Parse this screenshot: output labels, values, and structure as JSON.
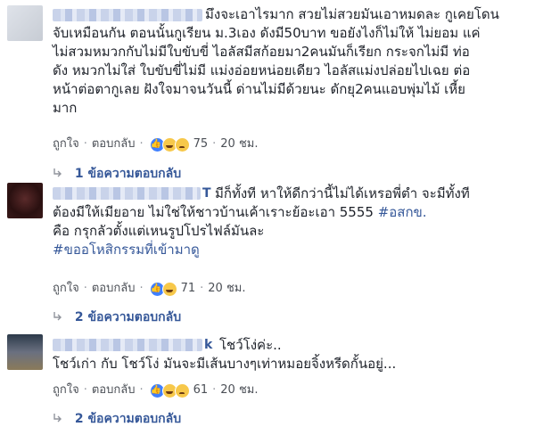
{
  "comments": [
    {
      "name_suffix": "",
      "lines": [
        "มึงจะเอาไรมาก สวยไม่สวยมันเอาหมดละ กูเคยโดน",
        "จับเหมือนกัน ตอนนั้นกูเรียน ม.3เอง ดังมี50บาท ขอยังไงก็ไม่ให้ ไม่ยอม แค่",
        "ไม่สวมหมวกกับไม่มีใบขับขี่ ไอลัสมีสก้อยมา2คนมันก็เรียก กระจกไม่มี ท่อ",
        "ดัง หมวกไม่ใส่ ใบขับขี่ไม่มี แม่งอ่อยหน่อยเดียว ไอลัสแม่งปล่อยไปเฉย ต่อ",
        "หน้าต่อตากูเลย ฝังใจมาจนวันนี้ ด่านไม่มีด้วยนะ ดักยุ2คนแอบพุ่มไม้ เหี้ย",
        "มาก"
      ],
      "like": "ถูกใจ",
      "reply": "ตอบกลับ",
      "count": "75",
      "time": "20 ชม.",
      "replies": "1 ข้อความตอบกลับ"
    },
    {
      "name_suffix": "T",
      "lines": [
        "มีก็ทั้งที หาให้ดีกว่านี้ไม่ได้เหรอพี่ตำ จะมีทั้งที",
        "ต้องมีให้เมียอาย ไม่ใช่ให้ชาวบ้านเค้าเราะย้อะเอา 5555",
        "คือ กรุกลัวตั้งแต่เหนรูปโปรไฟล์มันละ"
      ],
      "hashtag1": "#อสกข.",
      "hashtag2": "#ขออโหสิกรรมที่เข้ามาดู",
      "like": "ถูกใจ",
      "reply": "ตอบกลับ",
      "count": "71",
      "time": "20 ชม.",
      "replies": "2 ข้อความตอบกลับ"
    },
    {
      "name_suffix": "k",
      "first_line": "โชว์โง่ค่ะ..",
      "lines": [
        "โชว์เก่า กับ โชว์โง่ มันจะมีเส้นบางๆเท่าหมอยจิ้งหรีดกั้นอยู่..."
      ],
      "like": "ถูกใจ",
      "reply": "ตอบกลับ",
      "count": "61",
      "time": "20 ชม.",
      "replies": "2 ข้อความตอบกลับ"
    }
  ],
  "colors": {
    "link": "#365899",
    "text": "#1d2129",
    "meta": "#4b4f56",
    "like_blue": "#4080ff",
    "emoji_yellow": "#f7c84a"
  },
  "icons": [
    "like-reaction-icon",
    "haha-reaction-icon",
    "sad-reaction-icon",
    "reply-arrow-icon"
  ]
}
